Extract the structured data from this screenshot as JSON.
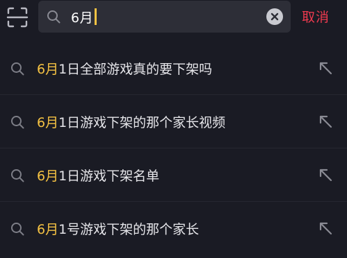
{
  "search": {
    "query": "6月"
  },
  "header": {
    "cancel_label": "取消"
  },
  "suggestions": [
    {
      "highlight": "6月",
      "rest": "1日全部游戏真的要下架吗"
    },
    {
      "highlight": "6月",
      "rest": "1日游戏下架的那个家长视频"
    },
    {
      "highlight": "6月",
      "rest": "1日游戏下架名单"
    },
    {
      "highlight": "6月",
      "rest": "1号游戏下架的那个家长"
    }
  ],
  "colors": {
    "background": "#1a1b24",
    "search_box": "#2d2e37",
    "highlight": "#f6c343",
    "cancel": "#ee3a4f",
    "text": "#e6e6ea",
    "icon": "#8a8b94"
  },
  "icons": {
    "scan": "scan-icon",
    "search": "search-icon",
    "clear": "clear-icon",
    "fill": "arrow-up-left-icon"
  }
}
